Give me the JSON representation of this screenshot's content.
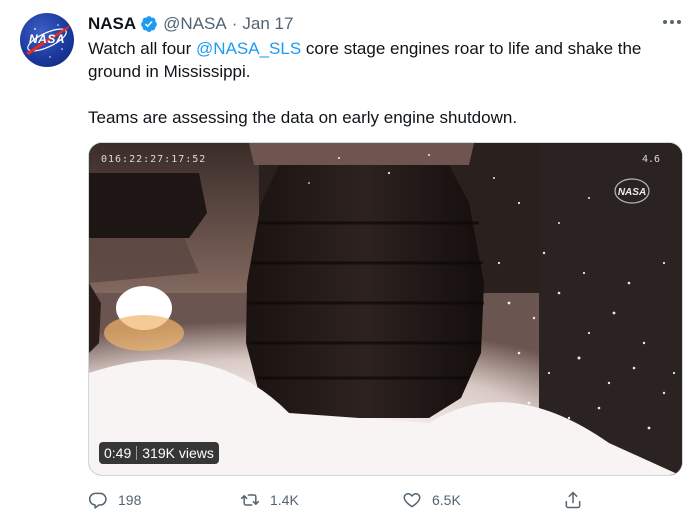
{
  "tweet": {
    "author": {
      "name": "NASA",
      "handle": "@NASA",
      "avatar_label": "NASA",
      "verified_icon": "verified-badge-icon"
    },
    "separator": "·",
    "date": "Jan 17",
    "text": {
      "line1_prefix": "Watch all four ",
      "mention": "@NASA_SLS",
      "line1_suffix": " core stage engines roar to life and shake the ground in Mississippi.",
      "line2": "Teams are assessing the data on early engine shutdown."
    },
    "media": {
      "timecode": "016:22:27:17:52",
      "corner_number": "4.6",
      "overlay_logo": "NASA",
      "duration": "0:49",
      "views": "319K views"
    },
    "actions": {
      "reply_count": "198",
      "retweet_count": "1.4K",
      "like_count": "6.5K"
    }
  },
  "colors": {
    "accent": "#1d9bf0",
    "text_primary": "#0f1419",
    "text_secondary": "#536471"
  }
}
